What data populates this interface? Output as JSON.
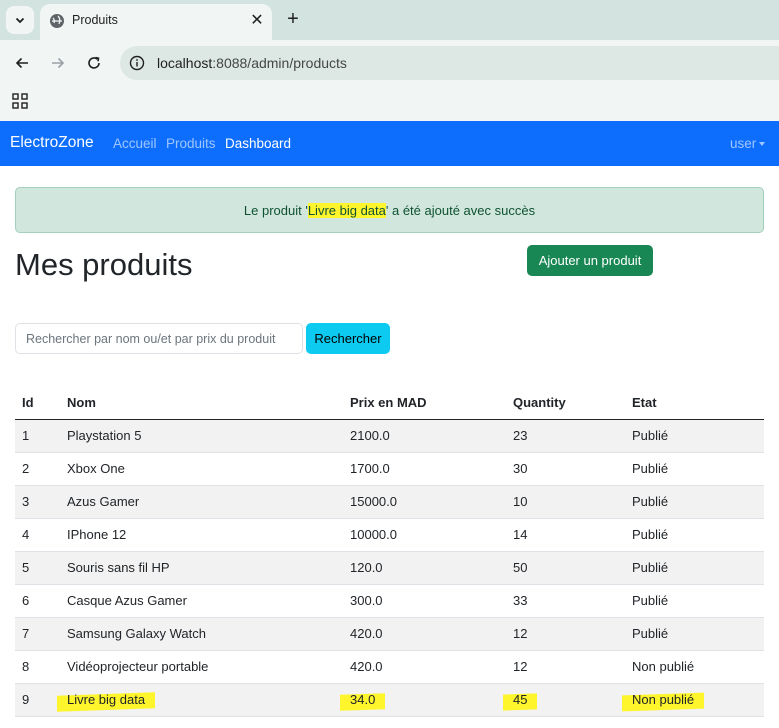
{
  "browser": {
    "tab_title": "Produits",
    "url_host": "localhost",
    "url_path": ":8088/admin/products"
  },
  "navbar": {
    "brand": "ElectroZone",
    "links": [
      "Accueil",
      "Produits",
      "Dashboard"
    ],
    "active_link": "Dashboard",
    "user_menu": "user"
  },
  "alert": {
    "prefix": "Le produit '",
    "product": "Livre big data",
    "suffix": "' a été ajouté avec succès"
  },
  "page": {
    "title": "Mes produits",
    "add_button": "Ajouter un produit"
  },
  "search": {
    "placeholder": "Rechercher par nom ou/et par prix du produit",
    "value": "",
    "button": "Rechercher"
  },
  "table": {
    "headers": [
      "Id",
      "Nom",
      "Prix en MAD",
      "Quantity",
      "Etat"
    ],
    "rows": [
      {
        "id": "1",
        "nom": "Playstation 5",
        "prix": "2100.0",
        "qty": "23",
        "etat": "Publié"
      },
      {
        "id": "2",
        "nom": "Xbox One",
        "prix": "1700.0",
        "qty": "30",
        "etat": "Publié"
      },
      {
        "id": "3",
        "nom": "Azus Gamer",
        "prix": "15000.0",
        "qty": "10",
        "etat": "Publié"
      },
      {
        "id": "4",
        "nom": "IPhone 12",
        "prix": "10000.0",
        "qty": "14",
        "etat": "Publié"
      },
      {
        "id": "5",
        "nom": "Souris sans fil HP",
        "prix": "120.0",
        "qty": "50",
        "etat": "Publié"
      },
      {
        "id": "6",
        "nom": "Casque Azus Gamer",
        "prix": "300.0",
        "qty": "33",
        "etat": "Publié"
      },
      {
        "id": "7",
        "nom": "Samsung Galaxy Watch",
        "prix": "420.0",
        "qty": "12",
        "etat": "Publié"
      },
      {
        "id": "8",
        "nom": "Vidéoprojecteur portable",
        "prix": "420.0",
        "qty": "12",
        "etat": "Non publié"
      },
      {
        "id": "9",
        "nom": "Livre big data",
        "prix": "34.0",
        "qty": "45",
        "etat": "Non publié"
      }
    ]
  },
  "colors": {
    "navbar": "#0d6efd",
    "alert_bg": "#d1e7dd",
    "add_button": "#198754",
    "search_button": "#0dcaf0",
    "highlight": "#fef52c"
  }
}
